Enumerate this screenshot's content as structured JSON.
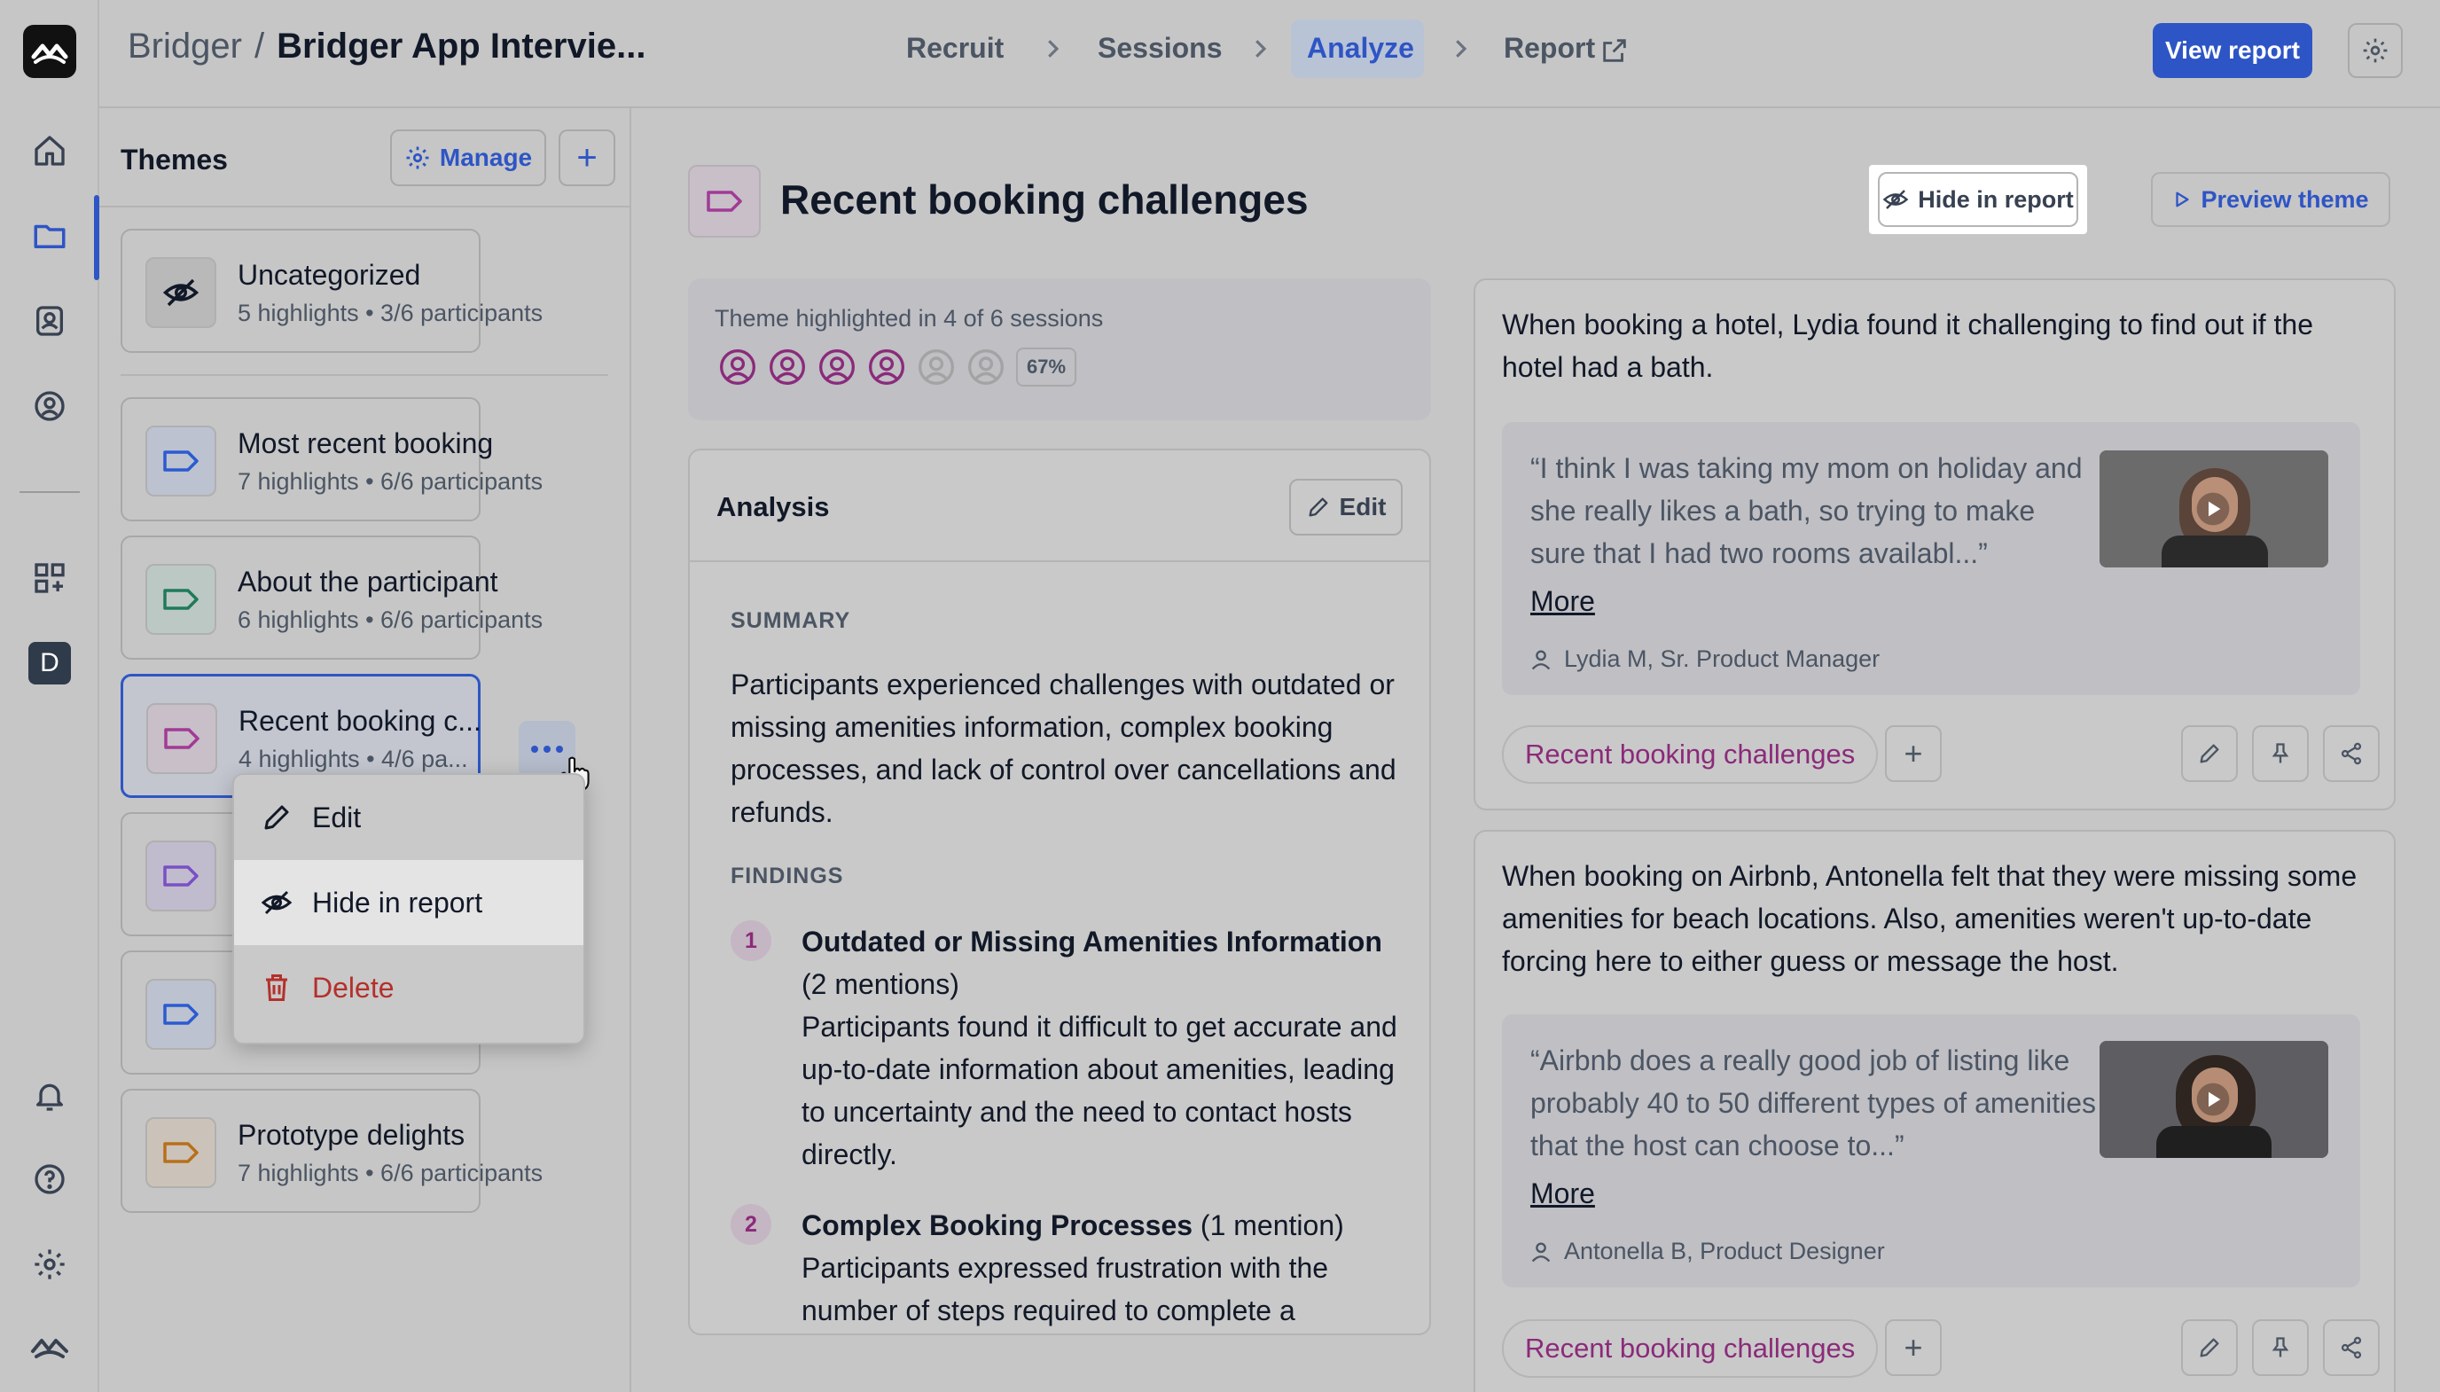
{
  "breadcrumb": {
    "project": "Bridger",
    "separator": "/",
    "study": "Bridger App Intervie..."
  },
  "steps": [
    {
      "label": "Recruit"
    },
    {
      "label": "Sessions"
    },
    {
      "label": "Analyze",
      "active": true
    },
    {
      "label": "Report",
      "icon": "external-link-icon"
    }
  ],
  "header": {
    "view_report_label": "View report",
    "settings_icon": "gear-icon"
  },
  "rail": {
    "workspace_initial": "D",
    "icons": [
      "logo-icon",
      "home-icon",
      "folder-icon",
      "contacts-icon",
      "user-settings-icon",
      "apps-icon",
      "bell-icon",
      "help-icon",
      "gear-icon",
      "brand-icon"
    ]
  },
  "themes": {
    "title": "Themes",
    "manage_label": "Manage",
    "add_label": "+",
    "items": [
      {
        "name": "Uncategorized",
        "meta": "5 highlights • 3/6 participants",
        "icon": "eye-off-icon"
      },
      {
        "name": "Most recent booking",
        "meta": "7 highlights • 6/6 participants",
        "icon": "tag-icon",
        "color": "#2b5bd1"
      },
      {
        "name": "About the participant",
        "meta": "6 highlights • 6/6 participants",
        "icon": "tag-icon",
        "color": "#1f7a5a"
      },
      {
        "name": "Recent booking c...",
        "meta": "4 highlights • 4/6 pa...",
        "icon": "tag-icon",
        "color": "#a13a96",
        "selected": true
      },
      {
        "name": "",
        "meta": "",
        "icon": "tag-icon",
        "color": "#7a4fc6"
      },
      {
        "name": "",
        "meta": "",
        "icon": "tag-icon",
        "color": "#2b5bd1"
      },
      {
        "name": "Prototype delights",
        "meta": "7 highlights • 6/6 participants",
        "icon": "tag-icon",
        "color": "#b7701a"
      }
    ]
  },
  "context_menu": {
    "edit": "Edit",
    "hide": "Hide in report",
    "delete": "Delete"
  },
  "theme": {
    "title": "Recent booking challenges",
    "hide_label": "Hide in report",
    "preview_label": "Preview theme",
    "sessions_text": "Theme highlighted in 4 of 6 sessions",
    "percent": "67%",
    "sessions_highlighted": 4,
    "sessions_total": 6
  },
  "analysis": {
    "title": "Analysis",
    "edit_label": "Edit",
    "summary_heading": "SUMMARY",
    "summary": "Participants experienced challenges with outdated or missing amenities information, complex booking processes, and lack of control over cancellations and refunds.",
    "findings_heading": "FINDINGS",
    "findings": [
      {
        "num": "1",
        "title": "Outdated or Missing Amenities Information",
        "mentions": "(2 mentions)",
        "body": "Participants found it difficult to get accurate and up-to-date information about amenities, leading to uncertainty and the need to contact hosts directly."
      },
      {
        "num": "2",
        "title": "Complex Booking Processes",
        "mentions": "(1 mention)",
        "body": "Participants expressed frustration with the number of steps required to complete a"
      }
    ]
  },
  "highlights": [
    {
      "summary": "When booking a hotel, Lydia found it challenging to find out if the hotel had a bath.",
      "quote": "“I think I was taking my mom on holiday and she really likes a bath, so trying to make sure that I had two rooms availabl...”",
      "more": "More",
      "person": "Lydia M, Sr. Product Manager",
      "tag": "Recent booking challenges",
      "add": "+"
    },
    {
      "summary": "When booking on Airbnb, Antonella felt that they were missing some amenities for beach locations. Also, amenities weren't up-to-date forcing here to either guess or message the host.",
      "quote": "“Airbnb does a really good job of listing like probably 40 to 50 different types of amenities that the host can choose to...”",
      "more": "More",
      "person": "Antonella B, Product Designer",
      "tag": "Recent booking challenges",
      "add": "+"
    }
  ]
}
